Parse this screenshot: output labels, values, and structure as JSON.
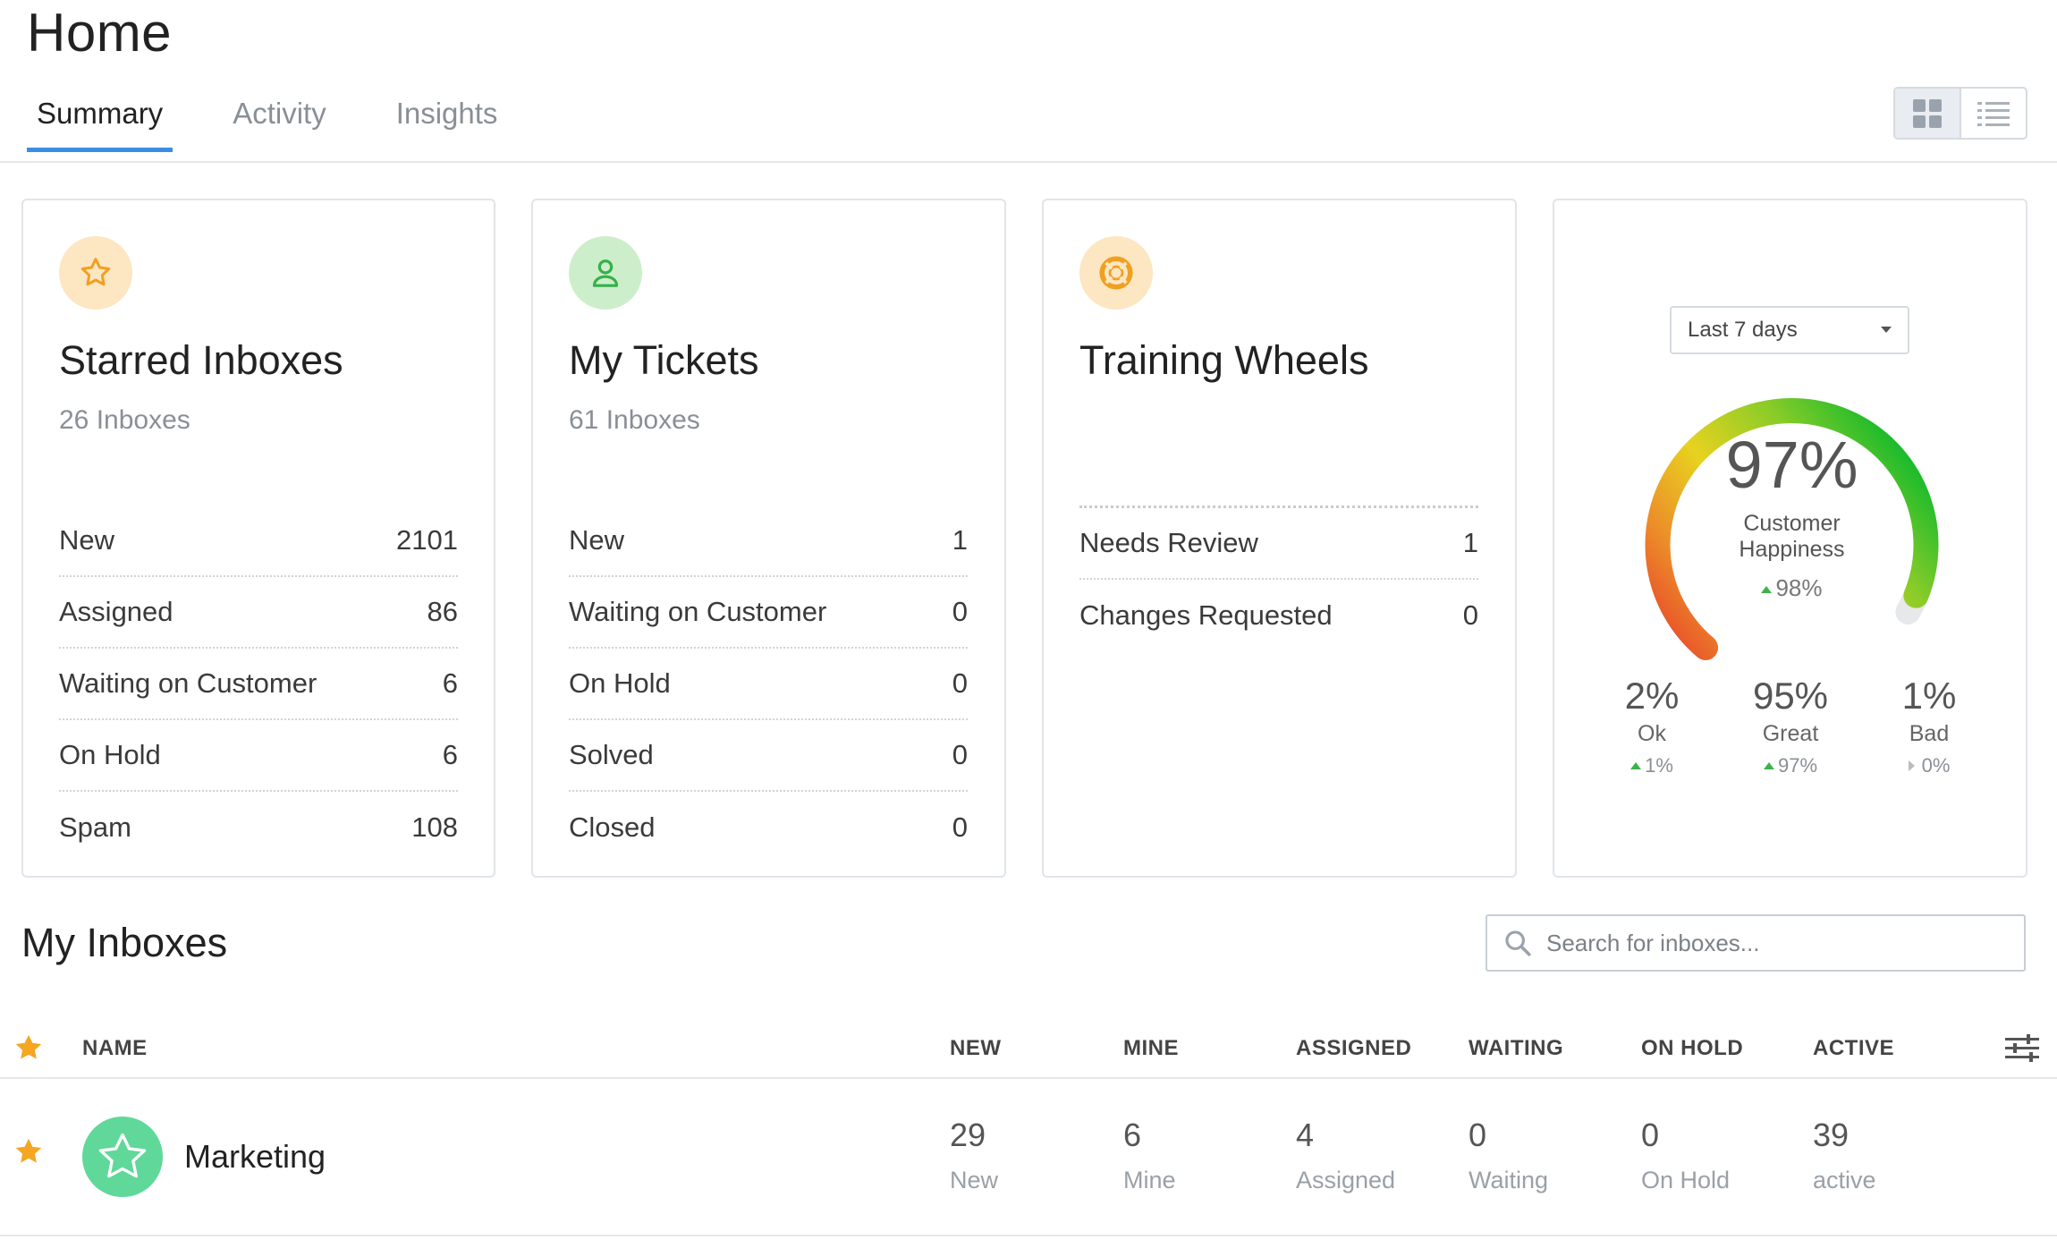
{
  "page": {
    "title": "Home"
  },
  "tabs": [
    {
      "label": "Summary",
      "active": true
    },
    {
      "label": "Activity",
      "active": false
    },
    {
      "label": "Insights",
      "active": false
    }
  ],
  "view_toggle": {
    "options": [
      "grid-view-icon",
      "list-view-icon"
    ],
    "selected": "grid-view-icon"
  },
  "cards": {
    "starred": {
      "icon": "star-icon",
      "icon_bg": "#fde6c2",
      "title": "Starred Inboxes",
      "subtitle": "26 Inboxes",
      "rows": [
        {
          "label": "New",
          "value": "2101"
        },
        {
          "label": "Assigned",
          "value": "86"
        },
        {
          "label": "Waiting on Customer",
          "value": "6"
        },
        {
          "label": "On Hold",
          "value": "6"
        },
        {
          "label": "Spam",
          "value": "108"
        }
      ]
    },
    "tickets": {
      "icon": "user-icon",
      "icon_bg": "#cdeeca",
      "title": "My Tickets",
      "subtitle": "61 Inboxes",
      "rows": [
        {
          "label": "New",
          "value": "1"
        },
        {
          "label": "Waiting on Customer",
          "value": "0"
        },
        {
          "label": "On Hold",
          "value": "0"
        },
        {
          "label": "Solved",
          "value": "0"
        },
        {
          "label": "Closed",
          "value": "0"
        }
      ]
    },
    "training": {
      "icon": "lifebuoy-icon",
      "icon_bg": "#fde6c2",
      "title": "Training Wheels",
      "rows": [
        {
          "label": "Needs Review",
          "value": "1"
        },
        {
          "label": "Changes Requested",
          "value": "0"
        }
      ]
    },
    "happiness": {
      "range": "Last 7 days",
      "percent": "97%",
      "percent_value": 0.97,
      "label_line1": "Customer",
      "label_line2": "Happiness",
      "delta": "98%",
      "breakdown": [
        {
          "pct": "2%",
          "label": "Ok",
          "delta": "1%",
          "trend": "up"
        },
        {
          "pct": "95%",
          "label": "Great",
          "delta": "97%",
          "trend": "up"
        },
        {
          "pct": "1%",
          "label": "Bad",
          "delta": "0%",
          "trend": "flat"
        }
      ],
      "colors": {
        "trend_up": "#3cb34a",
        "gauge_low": "#e8412b",
        "gauge_mid": "#e8d21f",
        "gauge_high": "#1dbb2c"
      }
    }
  },
  "inboxes": {
    "title": "My Inboxes",
    "search_placeholder": "Search for inboxes...",
    "columns": [
      "NAME",
      "NEW",
      "MINE",
      "ASSIGNED",
      "WAITING",
      "ON HOLD",
      "ACTIVE"
    ],
    "rows": [
      {
        "starred": true,
        "name": "Marketing",
        "avatar_color": "#5fd89a",
        "cells": [
          {
            "value": "29",
            "label": "New"
          },
          {
            "value": "6",
            "label": "Mine"
          },
          {
            "value": "4",
            "label": "Assigned"
          },
          {
            "value": "0",
            "label": "Waiting"
          },
          {
            "value": "0",
            "label": "On Hold"
          },
          {
            "value": "39",
            "label": "active"
          }
        ]
      }
    ]
  }
}
